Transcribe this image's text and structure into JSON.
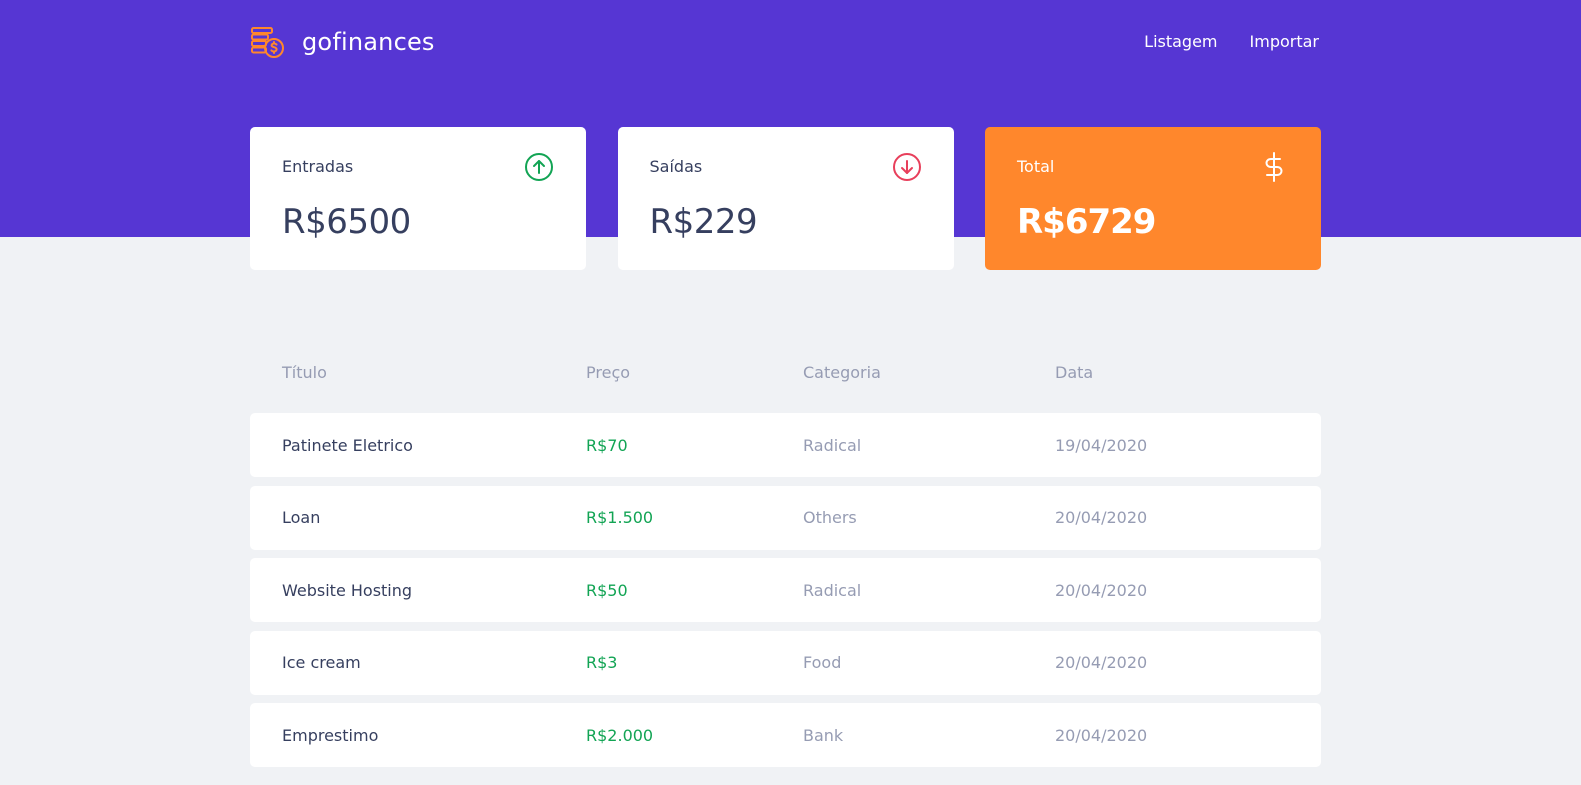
{
  "app": {
    "name": "gofinances"
  },
  "nav": {
    "items": [
      "Listagem",
      "Importar"
    ]
  },
  "summary": {
    "income": {
      "label": "Entradas",
      "value": "R$6500",
      "icon": "arrow-up-circle-icon",
      "color": "#12A454"
    },
    "outcome": {
      "label": "Saídas",
      "value": "R$229",
      "icon": "arrow-down-circle-icon",
      "color": "#E83F5B"
    },
    "total": {
      "label": "Total",
      "value": "R$6729",
      "icon": "dollar-sign-icon",
      "color": "#FF872C"
    }
  },
  "table": {
    "headers": {
      "title": "Título",
      "price": "Preço",
      "category": "Categoria",
      "date": "Data"
    },
    "rows": [
      {
        "title": "Patinete Eletrico",
        "price": "R$70",
        "category": "Radical",
        "date": "19/04/2020"
      },
      {
        "title": "Loan",
        "price": "R$1.500",
        "category": "Others",
        "date": "20/04/2020"
      },
      {
        "title": "Website Hosting",
        "price": "R$50",
        "category": "Radical",
        "date": "20/04/2020"
      },
      {
        "title": "Ice cream",
        "price": "R$3",
        "category": "Food",
        "date": "20/04/2020"
      },
      {
        "title": "Emprestimo",
        "price": "R$2.000",
        "category": "Bank",
        "date": "20/04/2020"
      }
    ]
  },
  "colors": {
    "header_bg": "#5636D3",
    "page_bg": "#F0F2F5",
    "income": "#12A454",
    "outcome": "#E83F5B",
    "total_bg": "#FF872C",
    "text_title": "#363F5F",
    "text_muted": "#969CB3"
  }
}
